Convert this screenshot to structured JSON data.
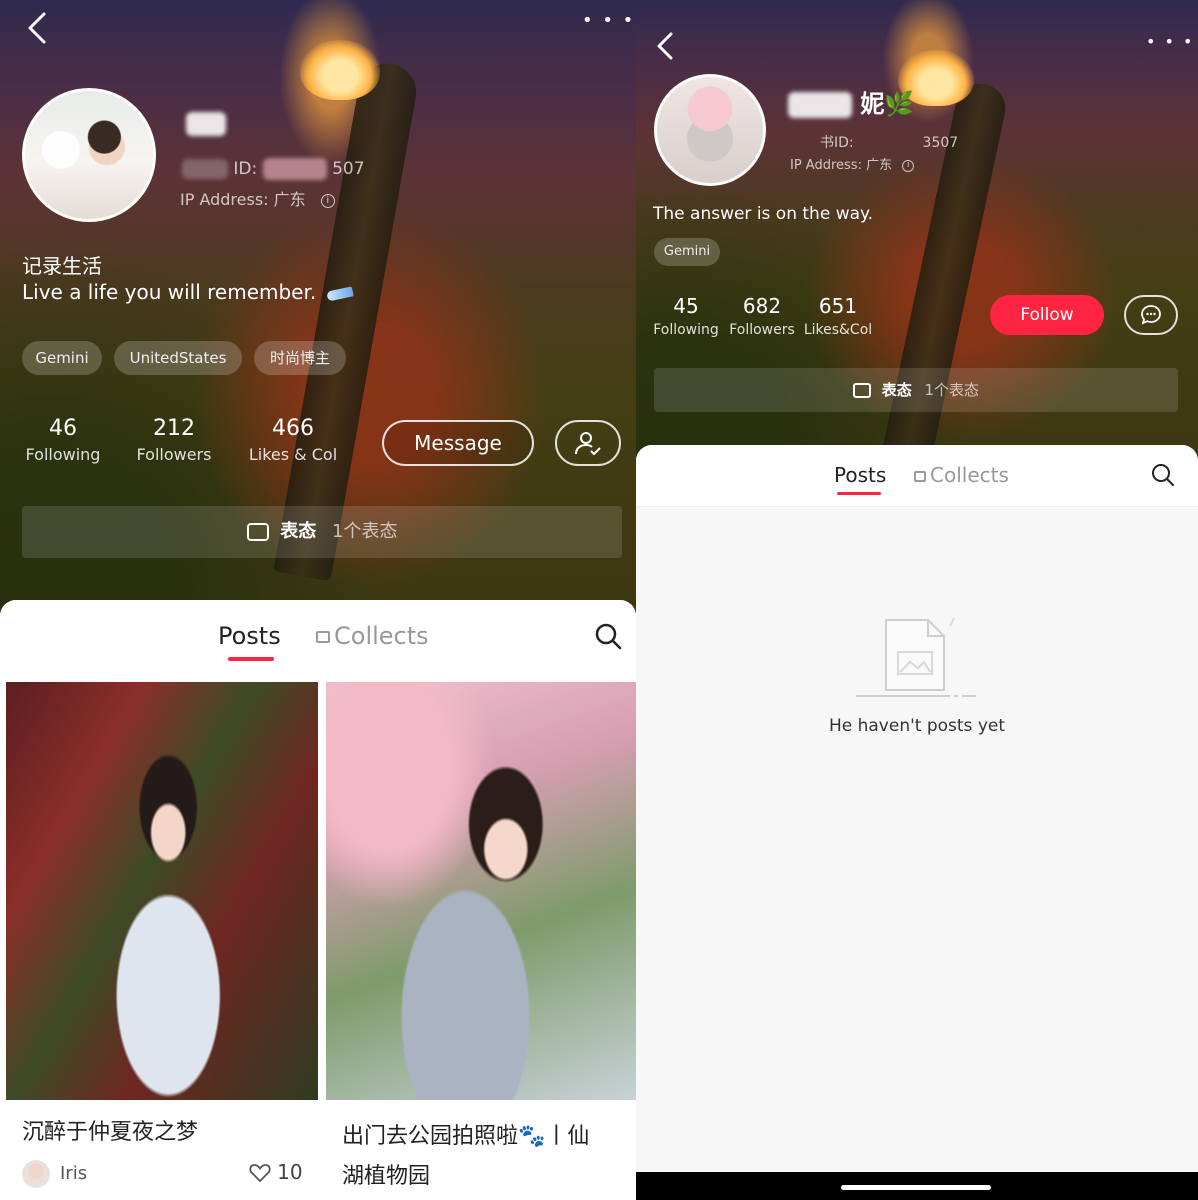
{
  "left": {
    "more": "• • •",
    "profile": {
      "user_id_label": "ID:",
      "user_id_suffix": "507",
      "ip_address": "IP Address: 广东",
      "bio_line1": "记录生活",
      "bio_line2": "Live a life you will remember."
    },
    "tags": [
      "Gemini",
      "UnitedStates",
      "时尚博主"
    ],
    "stats": [
      {
        "num": "46",
        "label": "Following"
      },
      {
        "num": "212",
        "label": "Followers"
      },
      {
        "num": "466",
        "label": "Likes & Col"
      }
    ],
    "message_button": "Message",
    "status_bar": {
      "label": "表态",
      "count": "1个表态"
    },
    "tabs": {
      "posts": "Posts",
      "collects": "Collects"
    },
    "posts": [
      {
        "title": "沉醉于仲夏夜之梦",
        "author": "Iris",
        "likes": "10"
      },
      {
        "title_line1": "出门去公园拍照啦🐾丨仙",
        "title_line2": "湖植物园"
      }
    ]
  },
  "right": {
    "more": "• • •",
    "profile": {
      "name_visible": "妮🌿",
      "id_label": "书ID:",
      "id_suffix": "3507",
      "ip_address": "IP Address: 广东",
      "bio": "The answer is on the way."
    },
    "tags": [
      "Gemini"
    ],
    "stats": [
      {
        "num": "45",
        "label": "Following"
      },
      {
        "num": "682",
        "label": "Followers"
      },
      {
        "num": "651",
        "label": "Likes&Col"
      }
    ],
    "follow_button": "Follow",
    "status_bar": {
      "label": "表态",
      "count": "1个表态"
    },
    "tabs": {
      "posts": "Posts",
      "collects": "Collects"
    },
    "empty_text": "He haven't posts yet"
  },
  "colors": {
    "accent": "#ff2442"
  }
}
